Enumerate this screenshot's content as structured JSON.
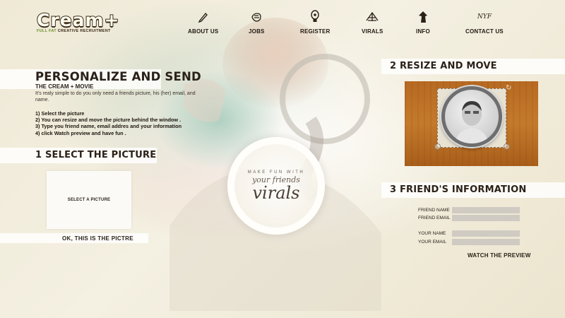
{
  "brand": {
    "logo": "Cream+",
    "tagline_a": "FULL FAT",
    "tagline_b": "CREATIVE RECRUITMENT"
  },
  "nav": [
    {
      "label": "ABOUT US",
      "icon": "pencil-icon"
    },
    {
      "label": "JOBS",
      "icon": "hand-icon"
    },
    {
      "label": "REGISTER",
      "icon": "lightbulb-icon"
    },
    {
      "label": "VIRALS",
      "icon": "virus-icon"
    },
    {
      "label": "INFO",
      "icon": "info-figure-icon"
    },
    {
      "label": "CONTACT US",
      "icon": "nyf-icon",
      "icon_text": "NYF"
    }
  ],
  "intro": {
    "title": "PERSONALIZE AND SEND",
    "subtitle": "THE CREAM + MOVIE",
    "description": "It's realy simple to do you only need a friends picture, his (her) email, and name.",
    "steps": [
      "1) Select the picture",
      "2) You can resize and move the picture behind the window .",
      "3) Type you friend name, email addres and your information",
      "4) click Watch preview and have fun ."
    ]
  },
  "section1": {
    "title": "1 SELECT THE PICTURE",
    "select_label": "SELECT A PICTURE",
    "ok_label": "OK, THIS  IS THE PICTRE"
  },
  "center": {
    "line1": "MAKE FUN WITH",
    "line2": "your friends",
    "line3": "virals"
  },
  "section2": {
    "title": "2 RESIZE AND MOVE"
  },
  "section3": {
    "title": "3 FRIEND'S INFORMATION",
    "fields": [
      {
        "label": "FRIEND NAME",
        "value": ""
      },
      {
        "label": "FRIEND EMAIL",
        "value": ""
      },
      {
        "label": "YOUR NAME",
        "value": ""
      },
      {
        "label": "YOUR EMAIL",
        "value": ""
      }
    ],
    "watch_label": "WATCH THE PREVIEW"
  },
  "colors": {
    "paper": "#f1ecdc",
    "ink": "#2b2118",
    "wood": "#b76a22",
    "field": "#cfcbc2"
  }
}
